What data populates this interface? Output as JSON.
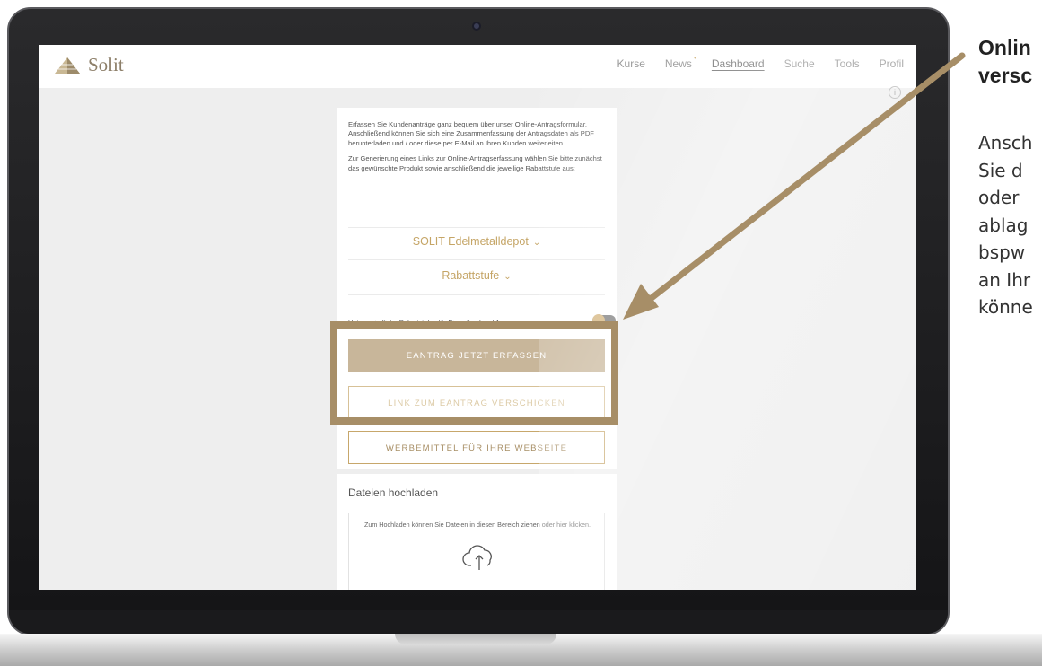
{
  "brand": {
    "name": "Solit"
  },
  "nav": {
    "items": [
      {
        "label": "Kurse",
        "active": false
      },
      {
        "label": "News",
        "active": false,
        "badge": "•"
      },
      {
        "label": "Dashboard",
        "active": true
      },
      {
        "label": "Suche",
        "active": false
      },
      {
        "label": "Tools",
        "active": false
      },
      {
        "label": "Profil",
        "active": false
      }
    ],
    "info_glyph": "i"
  },
  "main": {
    "intro_paragraphs": [
      "Erfassen Sie Kundenanträge ganz bequem über unser Online-Antragsformular. Anschließend können Sie sich eine Zusammenfassung der Antragsdaten als PDF herunterladen und / oder diese per E-Mail an Ihren Kunden weiterleiten.",
      "Zur Generierung eines Links zur Online-Antragserfassung wählen Sie bitte zunächst das gewünschte Produkt sowie anschließend die jeweilige Rabattstufe aus:"
    ],
    "product_select": {
      "value": "SOLIT Edelmetalldepot"
    },
    "discount_select": {
      "value": "Rabattstufe"
    },
    "toggle_label": "Unterschiedliche Rabattstufen für Einmalkauf und Ansparplan",
    "toggle_on": true,
    "buttons": {
      "primary": "EANTRAG JETZT ERFASSEN",
      "send_link": "LINK ZUM EANTRAG VERSCHICKEN",
      "ad_material": "WERBEMITTEL FÜR IHRE WEBSEITE"
    }
  },
  "upload": {
    "title": "Dateien hochladen",
    "hint": "Zum Hochladen können Sie Dateien in diesen Bereich ziehen oder hier klicken."
  },
  "callout": {
    "title": "Onlin\nversc",
    "text": "Ansch\nSie d\noder\nablag\nbspw\nan Ihr\nkönne"
  },
  "colors": {
    "accent_gold": "#c5a566",
    "annotation_brown": "#a78e67",
    "primary_button": "#c8b69a"
  }
}
